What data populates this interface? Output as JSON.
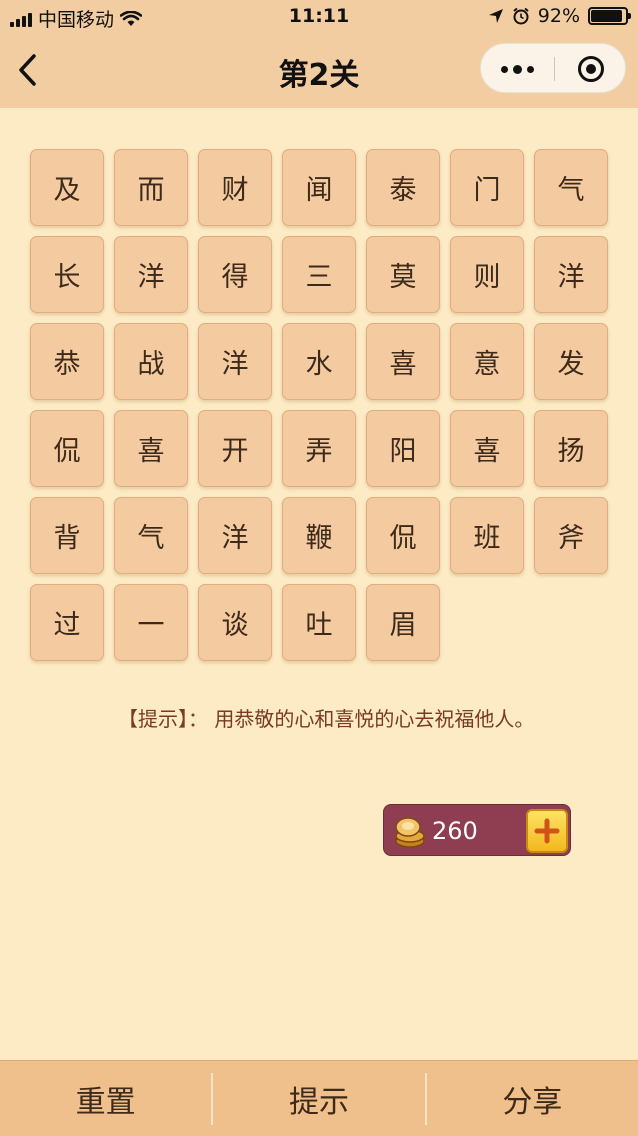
{
  "status_bar": {
    "carrier": "中国移动",
    "time": "11:11",
    "battery": "92%",
    "battery_level": 0.92
  },
  "nav": {
    "title": "第2关"
  },
  "grid": {
    "tiles": [
      "及",
      "而",
      "财",
      "闻",
      "泰",
      "门",
      "气",
      "长",
      "洋",
      "得",
      "三",
      "莫",
      "则",
      "洋",
      "恭",
      "战",
      "洋",
      "水",
      "喜",
      "意",
      "发",
      "侃",
      "喜",
      "开",
      "弄",
      "阳",
      "喜",
      "扬",
      "背",
      "气",
      "洋",
      "鞭",
      "侃",
      "班",
      "斧",
      "过",
      "一",
      "谈",
      "吐",
      "眉"
    ]
  },
  "hint": {
    "text": "【提示】：  用恭敬的心和喜悦的心去祝福他人。"
  },
  "coins": {
    "count": "260"
  },
  "bottom_bar": {
    "reset_label": "重置",
    "hint_label": "提示",
    "share_label": "分享"
  },
  "colors": {
    "background": "#fcebc4",
    "header": "#f3cda2",
    "tile": "#f4cba1",
    "hint_text": "#7a3a26",
    "coin_box": "#8e3e50",
    "plus_button": "#f6c52a",
    "bottom_bar": "#f0c08c"
  }
}
